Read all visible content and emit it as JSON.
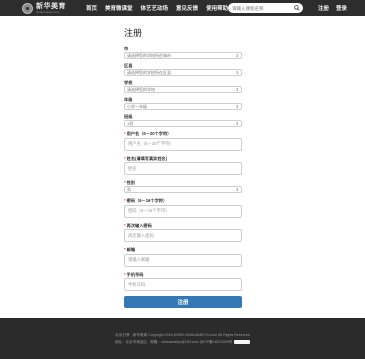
{
  "header": {
    "logo_title": "新华美育",
    "logo_sub": "xinhuameiyu.com",
    "nav": [
      "首页",
      "美育微课堂",
      "体艺艺动场",
      "意见反馈",
      "使用帮助"
    ],
    "search_placeholder": "请输入课程名称",
    "login": "注册",
    "register": "登录"
  },
  "form": {
    "title": "注册",
    "fields": {
      "city_label": "市",
      "city_value": "请选择您的学校所在城市",
      "district_label": "区县",
      "district_value": "请选择您的学校所在区县",
      "school_label": "学校",
      "school_value": "请选择您的学校",
      "grade_label": "年级",
      "grade_value": "小学一年级",
      "class_label": "班级",
      "class_value": "1班",
      "username_label": "用户名（6－20个字符）",
      "username_placeholder": "用户名（6－20个字符）",
      "name_label": "姓名(请填写真实姓名)",
      "name_placeholder": "姓名",
      "gender_label": "性别",
      "gender_value": "男",
      "password_label": "密码（6－16个字符）",
      "password_placeholder": "密码（6－16个字符）",
      "confirm_label": "再次输入密码",
      "confirm_placeholder": "再次输入密码",
      "email_label": "邮箱",
      "email_placeholder": "请输入邮箱",
      "phone_label": "手机号码",
      "phone_placeholder": "手机号码"
    },
    "submit": "注册"
  },
  "footer": {
    "line1": "北京分享 · 新华美育 Copyright 2018 WWW.XINHUAMEIYU.com All Rights Reserved",
    "line2": "地址：北京市海淀区 · 邮箱：xinhuameiyu@163.com 京ICP备18013309号"
  },
  "colors": {
    "header_bg": "#2d2d2d",
    "submit_bg": "#3478b5",
    "footer_bg": "#2b2b2b",
    "required": "#d9534f"
  }
}
